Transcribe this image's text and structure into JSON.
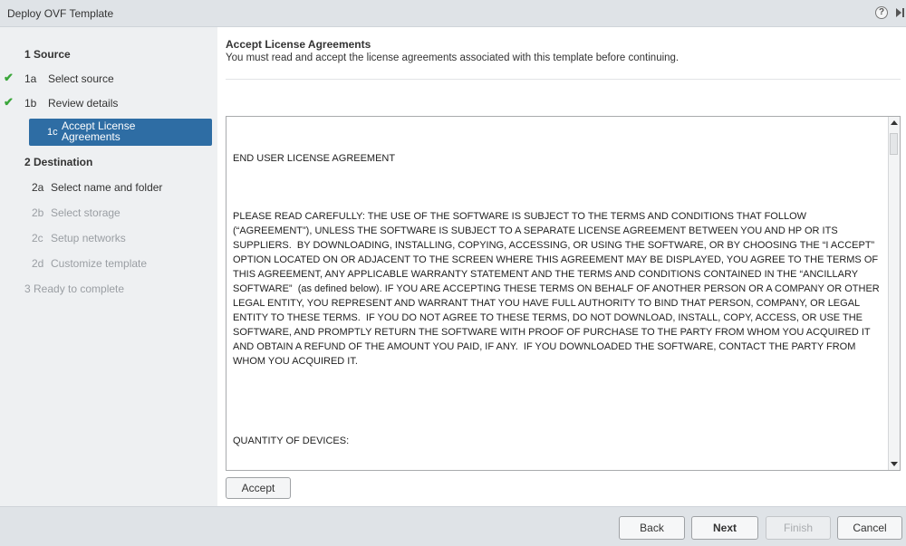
{
  "window": {
    "title": "Deploy OVF Template",
    "help_icon": "?"
  },
  "nav": {
    "sections": [
      {
        "label": "1 Source"
      },
      {
        "label": "2 Destination"
      },
      {
        "label": "3 Ready to complete"
      }
    ],
    "items": [
      {
        "num": "1a",
        "label": "Select source",
        "state": "done"
      },
      {
        "num": "1b",
        "label": "Review details",
        "state": "done"
      },
      {
        "num": "1c",
        "label": "Accept License Agreements",
        "state": "active"
      },
      {
        "num": "2a",
        "label": "Select name and folder",
        "state": "enabled"
      },
      {
        "num": "2b",
        "label": "Select storage",
        "state": "disabled"
      },
      {
        "num": "2c",
        "label": "Setup networks",
        "state": "disabled"
      },
      {
        "num": "2d",
        "label": "Customize template",
        "state": "disabled"
      }
    ],
    "check_glyph": "✔"
  },
  "content": {
    "title": "Accept License Agreements",
    "description": "You must read and accept the license agreements associated with this template before continuing.",
    "license_heading": "END USER LICENSE AGREEMENT",
    "license_body": "PLEASE READ CAREFULLY: THE USE OF THE SOFTWARE IS SUBJECT TO THE TERMS AND CONDITIONS THAT FOLLOW (“AGREEMENT”), UNLESS THE SOFTWARE IS SUBJECT TO A SEPARATE LICENSE AGREEMENT BETWEEN YOU AND HP OR ITS SUPPLIERS.  BY DOWNLOADING, INSTALLING, COPYING, ACCESSING, OR USING THE SOFTWARE, OR BY CHOOSING THE “I ACCEPT” OPTION LOCATED ON OR ADJACENT TO THE SCREEN WHERE THIS AGREEMENT MAY BE DISPLAYED, YOU AGREE TO THE TERMS OF THIS AGREEMENT, ANY APPLICABLE WARRANTY STATEMENT AND THE TERMS AND CONDITIONS CONTAINED IN THE “ANCILLARY SOFTWARE”  (as defined below). IF YOU ARE ACCEPTING THESE TERMS ON BEHALF OF ANOTHER PERSON OR A COMPANY OR OTHER LEGAL ENTITY, YOU REPRESENT AND WARRANT THAT YOU HAVE FULL AUTHORITY TO BIND THAT PERSON, COMPANY, OR LEGAL ENTITY TO THESE TERMS.  IF YOU DO NOT AGREE TO THESE TERMS, DO NOT DOWNLOAD, INSTALL, COPY, ACCESS, OR USE THE SOFTWARE, AND PROMPTLY RETURN THE SOFTWARE WITH PROOF OF PURCHASE TO THE PARTY FROM WHOM YOU ACQUIRED IT AND OBTAIN A REFUND OF THE AMOUNT YOU PAID, IF ANY.  IF YOU DOWNLOADED THE SOFTWARE, CONTACT THE PARTY FROM WHOM YOU ACQUIRED IT.",
    "license_footer": "QUANTITY OF DEVICES:",
    "accept_label": "Accept"
  },
  "footer": {
    "back_label": "Back",
    "next_label": "Next",
    "finish_label": "Finish",
    "cancel_label": "Cancel"
  },
  "colors": {
    "active_item": "#2e6da4",
    "check": "#3aa63a",
    "nav_bg": "#eef0f2",
    "bar_bg": "#dfe3e7"
  }
}
